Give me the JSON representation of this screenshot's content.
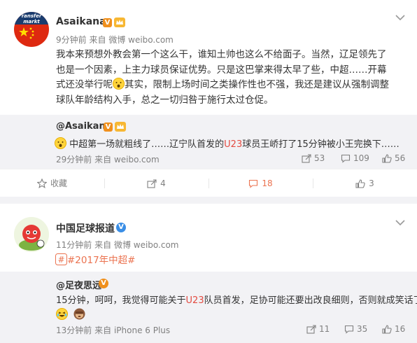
{
  "post1": {
    "author": "Asaikana",
    "avatar_text": "ransfer\nmarkt",
    "time": "9分钟前",
    "source_prefix": "来自",
    "source": "微博 weibo.com",
    "text_a": "我本来预想外教会第一个这么干，谁知土帅也这么不给面子。当然，辽足领先了",
    "text_b": "也是一个因素，上主力球员保证优势。只是这巴掌来得太早了些，中超……开幕",
    "text_c1": "式还没举行呢",
    "text_c2": "其实，限制上场时间之类操作性也不强，我还是建议从强制调整",
    "text_d": "球队年龄结构入手，总之一切归咎于施行太过仓促。",
    "repost": {
      "author": "@Asaikana",
      "text_a": "中超第一场就粗线了……辽宁队首发的",
      "text_red": "U23",
      "text_b": "球员王峤打了15分钟被小王完换下……",
      "time": "29分钟前",
      "source_prefix": "来自",
      "source": "weibo.com",
      "shares": "53",
      "comments": "109",
      "likes": "56"
    },
    "actions": {
      "favorite": "收藏",
      "share": "4",
      "comment": "18",
      "like": "3"
    }
  },
  "post2": {
    "author": "中国足球报道",
    "time": "11分钟前",
    "source_prefix": "来自",
    "source": "微博 weibo.com",
    "topic": "#2017年中超#",
    "repost": {
      "author": "@足夜思远",
      "text_a": "15分钟，呵呵，我觉得可能关于",
      "text_red": "U23",
      "text_b": "队员首发，足协可能还要出改良细则，否则就成笑话了",
      "time": "13分钟前",
      "source_prefix": "来自",
      "source": "iPhone 6 Plus",
      "shares": "11",
      "comments": "35",
      "likes": "16"
    }
  },
  "colors": {
    "accent": "#eb7350",
    "red_highlight": "#e34b41",
    "vip_orange": "#f0901d",
    "verified_blue": "#3a8ee6"
  },
  "icons": [
    "chevron-down-icon",
    "flag-avatar",
    "vip-badge-icon",
    "crown-icon",
    "star-icon",
    "share-icon",
    "comment-icon",
    "like-icon",
    "verified-icon",
    "topic-icon",
    "emoji-icon"
  ]
}
